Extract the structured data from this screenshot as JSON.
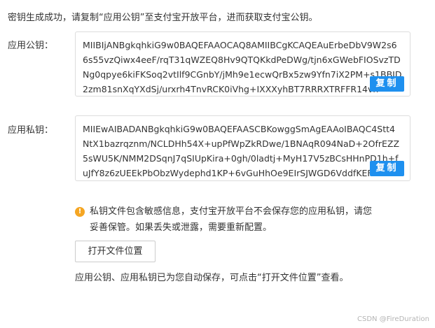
{
  "intro_text": "密钥生成成功，请复制“应用公钥”至支付宝开放平台，进而获取支付宝公钥。",
  "public_key": {
    "label": "应用公钥：",
    "lines": [
      "MIIBIjANBgkqhkiG9w0BAQEFAAOCAQ8AMIIBCgKCAQEAuErbeDbV9W2s6",
      "6s55vzQiwx4eeF/rqT31qWZEQ8Hv9QTQKkdPeDWg/tjn6xGWebFIOSvzTD",
      "Ng0qpye6kiFKSoq2vtIlf9CGnbY/jMh9e1ecwQrBx5zw9Yfn7iX2PM+s1BBJD",
      "2zm81snXqYXdSj/urxrh4TnvRCK0iVhg+IXXXyhBT7RRRXTRFFR14vn"
    ],
    "copy_label": "复制"
  },
  "private_key": {
    "label": "应用私钥：",
    "lines": [
      "MIIEwAIBADANBgkqhkiG9w0BAQEFAASCBKowggSmAgEAAoIBAQC4Stt4",
      "NtX1bazrqznm/NCLDHh54X+upPfWpZkRDwe/1BNAqR094NaD+2OfrEZZ",
      "5sWU5K/NMM2DSqnJ7qSIUpKira+0gh/0ladtj+MyH17V5zBCsHHnPD1h+f",
      "uJfY8z6zUEEkPbObzWydephd1KP+6vGuHhOe9EIrSJWGD6VddfKEF"
    ],
    "copy_label": "复制"
  },
  "warning": {
    "icon": "warning-icon",
    "icon_glyph": "!",
    "color": "#f5a623",
    "line1": "私钥文件包含敏感信息，支付宝开放平台不会保存您的应用私钥，请您",
    "line2": "妥善保管。如果丢失或泄露，需要重新配置。"
  },
  "open_location_button": "打开文件位置",
  "footer_note": "应用公钥、应用私钥已为您自动保存，可点击“打开文件位置”查看。",
  "watermark": "CSDN @FireDuration",
  "colors": {
    "copy_button": "#1e90ef",
    "warning": "#f5a623",
    "border": "#dcdcdc"
  }
}
